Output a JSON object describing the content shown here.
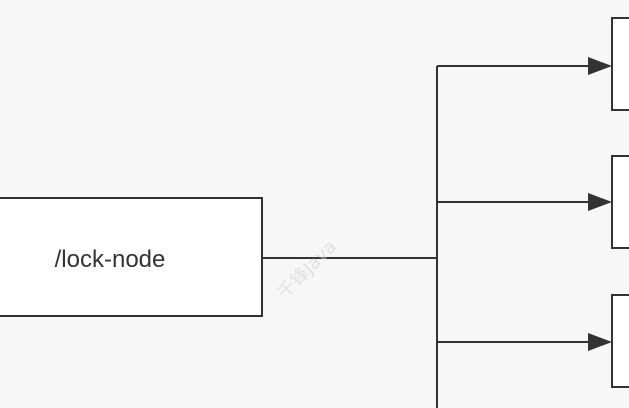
{
  "diagram": {
    "root_node": {
      "label": "/lock-node"
    },
    "child_nodes": [
      {
        "label": ""
      },
      {
        "label": ""
      },
      {
        "label": ""
      }
    ],
    "watermark": {
      "text": "千锋Java"
    }
  }
}
